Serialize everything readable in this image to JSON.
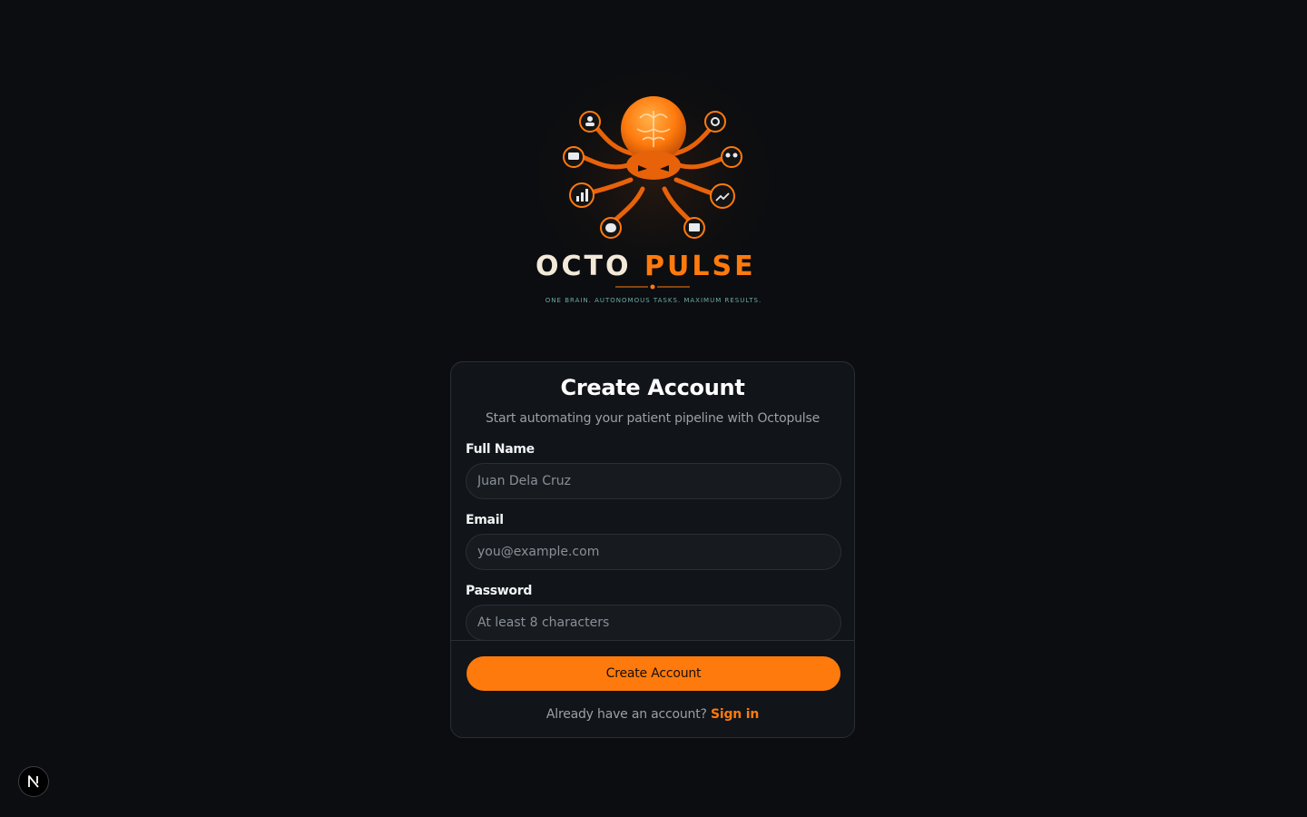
{
  "brand": {
    "logo_word_left": "OCTO",
    "logo_word_right": "PULSE",
    "tagline": "ONE BRAIN. AUTONOMOUS TASKS. MAXIMUM RESULTS.",
    "accent_color": "#ff7a0d",
    "logo_icons": [
      "user-icon",
      "gear-icon",
      "chat-icon",
      "users-icon",
      "bar-chart-icon",
      "trend-up-icon",
      "database-icon",
      "mail-icon"
    ]
  },
  "form": {
    "title": "Create Account",
    "subtitle": "Start automating your patient pipeline with Octopulse",
    "fields": {
      "full_name": {
        "label": "Full Name",
        "placeholder": "Juan Dela Cruz",
        "value": ""
      },
      "email": {
        "label": "Email",
        "placeholder": "you@example.com",
        "value": ""
      },
      "password": {
        "label": "Password",
        "placeholder": "At least 8 characters",
        "value": ""
      }
    },
    "submit_label": "Create Account",
    "signin_prompt": "Already have an account?",
    "signin_link": "Sign in"
  },
  "dev_badge": {
    "letter": "N"
  }
}
